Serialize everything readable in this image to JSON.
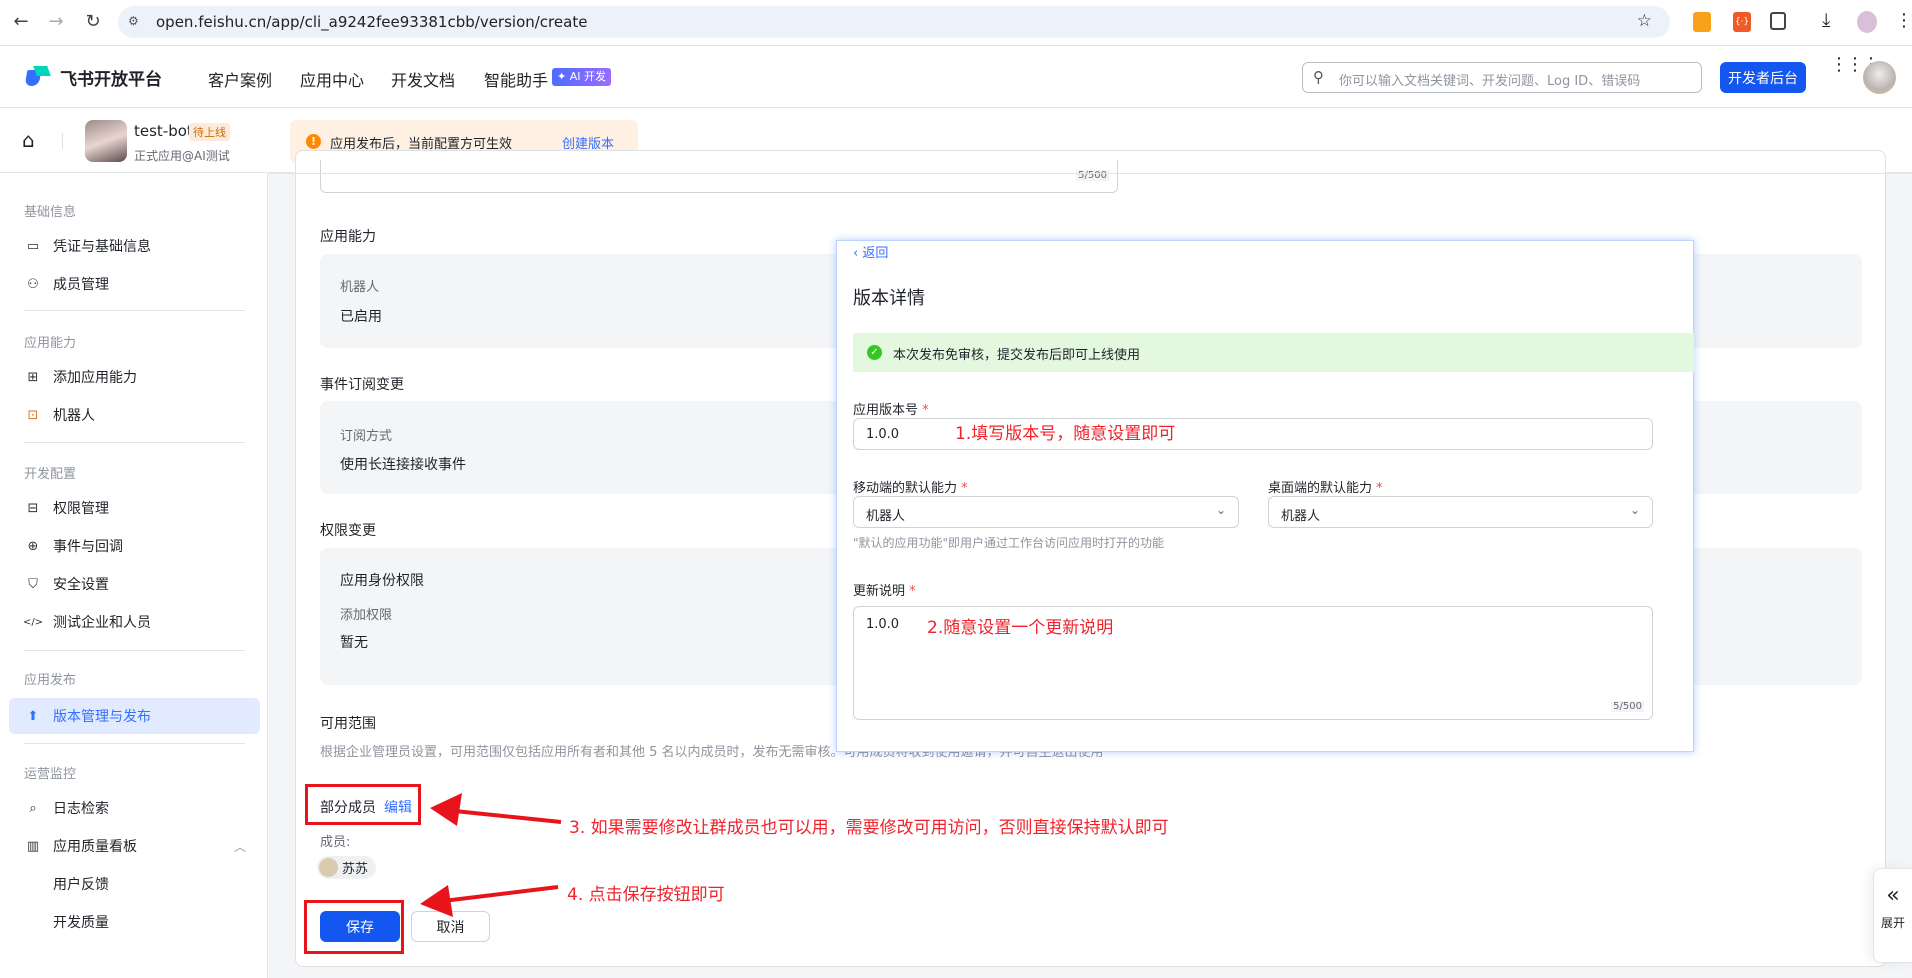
{
  "browser": {
    "url": "open.feishu.cn/app/cli_a9242fee93381cbb/version/create",
    "back_icon": "arrow-left",
    "forward_icon": "arrow-right",
    "reload_icon": "reload",
    "star_icon": "star",
    "download_icon": "download",
    "menu_icon": "kebab"
  },
  "header": {
    "brand": "飞书开放平台",
    "nav": [
      "客户案例",
      "应用中心",
      "开发文档",
      "智能助手"
    ],
    "ai_badge": "AI 开发",
    "search_placeholder": "你可以输入文档关键词、开发问题、Log ID、错误码",
    "console_button": "开发者后台",
    "accent": "#1456f0"
  },
  "app": {
    "name": "test-bot",
    "status_badge": "待上线",
    "subtitle": "正式应用@AI测试",
    "notice": "应用发布后，当前配置方可生效",
    "notice_link": "创建版本"
  },
  "sidebar": {
    "groups": [
      {
        "title": "基础信息",
        "items": [
          {
            "label": "凭证与基础信息",
            "icon": "card-icon"
          },
          {
            "label": "成员管理",
            "icon": "user-add-icon"
          }
        ]
      },
      {
        "title": "应用能力",
        "items": [
          {
            "label": "添加应用能力",
            "icon": "apps-add-icon"
          },
          {
            "label": "机器人",
            "icon": "robot-icon"
          }
        ]
      },
      {
        "title": "开发配置",
        "items": [
          {
            "label": "权限管理",
            "icon": "briefcase-icon"
          },
          {
            "label": "事件与回调",
            "icon": "event-icon"
          },
          {
            "label": "安全设置",
            "icon": "shield-icon"
          },
          {
            "label": "测试企业和人员",
            "icon": "code-icon"
          }
        ]
      },
      {
        "title": "应用发布",
        "items": [
          {
            "label": "版本管理与发布",
            "icon": "upload-icon",
            "selected": true
          }
        ]
      },
      {
        "title": "运营监控",
        "items": [
          {
            "label": "日志检索",
            "icon": "log-search-icon"
          },
          {
            "label": "应用质量看板",
            "icon": "bar-chart-icon",
            "expanded": true
          },
          {
            "label": "用户反馈"
          },
          {
            "label": "开发质量"
          }
        ]
      }
    ]
  },
  "main": {
    "top_counter": "5/500",
    "capability": {
      "title": "应用能力",
      "key": "机器人",
      "value": "已启用"
    },
    "events": {
      "title": "事件订阅变更",
      "key": "订阅方式",
      "value": "使用长连接接收事件"
    },
    "permissions": {
      "title": "权限变更",
      "section": "应用身份权限",
      "key": "添加权限",
      "value": "暂无"
    },
    "scope": {
      "title": "可用范围",
      "desc": "根据企业管理员设置，可用范围仅包括应用所有者和其他 5 名以内成员时，发布无需审核。可用成员将收到使用邀请，并可自主退出使用",
      "mode": "部分成员",
      "edit": "编辑",
      "members_label": "成员:",
      "members": [
        "苏苏"
      ]
    },
    "save": "保存",
    "cancel": "取消"
  },
  "panel": {
    "back": "返回",
    "title": "版本详情",
    "success": "本次发布免审核，提交发布后即可上线使用",
    "version_label": "应用版本号",
    "version_value": "1.0.0",
    "mobile_label": "移动端的默认能力",
    "mobile_value": "机器人",
    "desktop_label": "桌面端的默认能力",
    "desktop_value": "机器人",
    "hint": "\"默认的应用功能\"即用户通过工作台访问应用时打开的功能",
    "notes_label": "更新说明",
    "notes_value": "1.0.0",
    "notes_counter": "5/500"
  },
  "annotations": [
    "1.填写版本号，随意设置即可",
    "2.随意设置一个更新说明",
    "3. 如果需要修改让群成员也可以用，需要修改可用访问，否则直接保持默认即可",
    "4. 点击保存按钮即可"
  ],
  "expand": "展开"
}
